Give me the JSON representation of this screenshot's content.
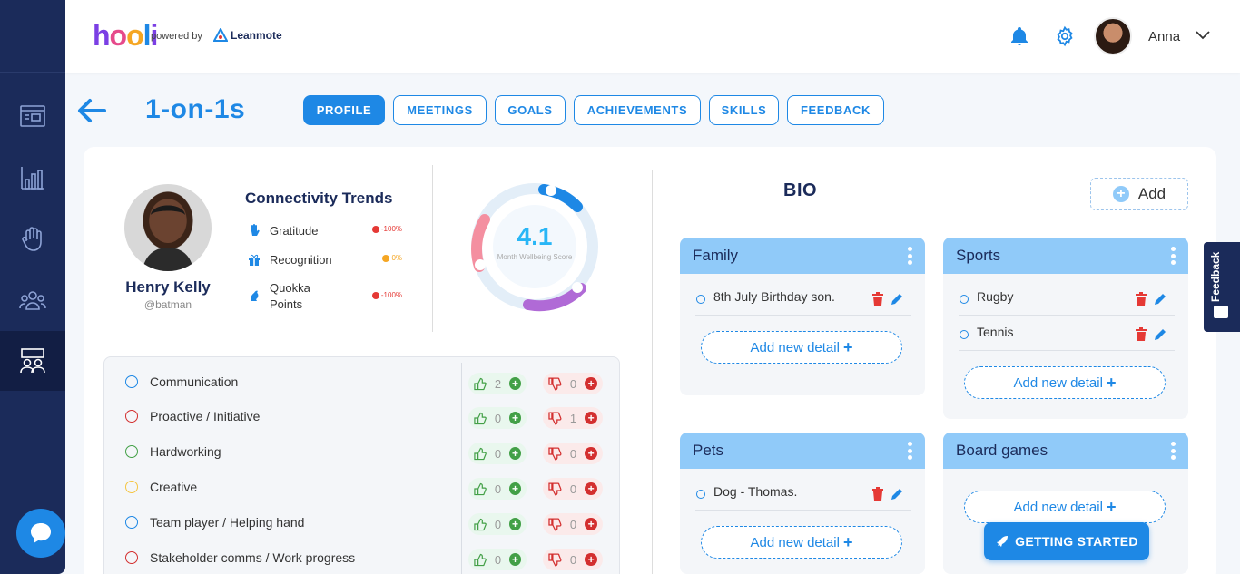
{
  "header": {
    "logo_text": "hooli",
    "powered_by": "powered by",
    "partner_name": "Leanmote",
    "user_name": "Anna"
  },
  "page": {
    "title": "1-on-1s",
    "tabs": [
      {
        "label": "PROFILE",
        "active": true
      },
      {
        "label": "MEETINGS",
        "active": false
      },
      {
        "label": "GOALS",
        "active": false
      },
      {
        "label": "ACHIEVEMENTS",
        "active": false
      },
      {
        "label": "SKILLS",
        "active": false
      },
      {
        "label": "FEEDBACK",
        "active": false
      }
    ]
  },
  "profile": {
    "name": "Henry Kelly",
    "handle": "@batman"
  },
  "trends": {
    "title": "Connectivity Trends",
    "items": [
      {
        "label": "Gratitude",
        "value": "-100%",
        "color": "#e53935"
      },
      {
        "label": "Recognition",
        "value": "0%",
        "color": "#f5a623"
      },
      {
        "label": "Quokka\nPoints",
        "value": "-100%",
        "color": "#e53935"
      }
    ]
  },
  "wellbeing": {
    "score": "4.1",
    "label": "Month Wellbeing Score"
  },
  "skills": [
    {
      "name": "Communication",
      "up": "2",
      "down": "0",
      "color": "#1e88e5"
    },
    {
      "name": "Proactive / Initiative",
      "up": "0",
      "down": "1",
      "color": "#d32f2f"
    },
    {
      "name": "Hardworking",
      "up": "0",
      "down": "0",
      "color": "#43a047"
    },
    {
      "name": "Creative",
      "up": "0",
      "down": "0",
      "color": "#f5c542"
    },
    {
      "name": "Team player / Helping hand",
      "up": "0",
      "down": "0",
      "color": "#1e88e5"
    },
    {
      "name": "Stakeholder comms / Work progress",
      "up": "0",
      "down": "0",
      "color": "#d32f2f"
    }
  ],
  "bio": {
    "title": "BIO",
    "add_label": "Add",
    "add_detail_label": "Add new detail",
    "cards": [
      {
        "title": "Family",
        "items": [
          "8th July Birthday son."
        ]
      },
      {
        "title": "Sports",
        "items": [
          "Rugby",
          "Tennis"
        ]
      },
      {
        "title": "Pets",
        "items": [
          "Dog - Thomas."
        ]
      },
      {
        "title": "Board games",
        "items": []
      }
    ]
  },
  "feedback_tab": "Feedback",
  "getting_started": "GETTING STARTED",
  "colors": {
    "primary": "#1e88e5",
    "sidebar": "#1b2b5a",
    "bio_header": "#90caf9"
  }
}
